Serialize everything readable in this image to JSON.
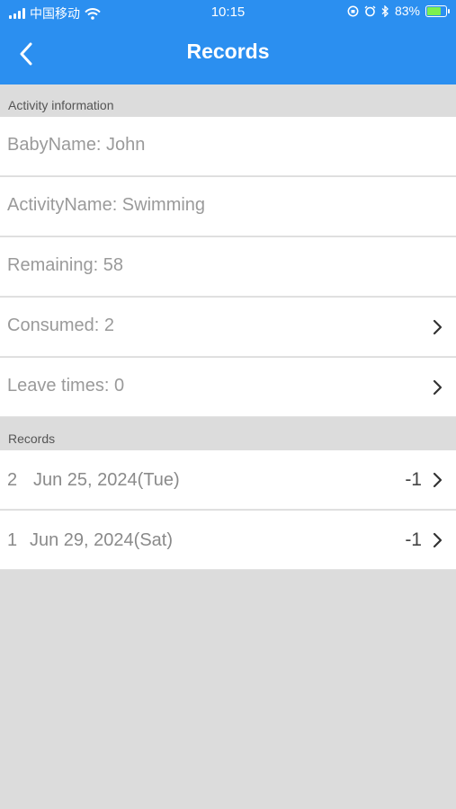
{
  "status_bar": {
    "carrier": "中国移动",
    "time": "10:15",
    "battery_percent": "83%",
    "battery_level": 0.83,
    "icons": [
      "signal-icon",
      "wifi-icon",
      "orientation-lock-icon",
      "alarm-icon",
      "bluetooth-icon",
      "battery-icon"
    ]
  },
  "nav": {
    "title": "Records",
    "back_icon": "chevron-left-icon"
  },
  "colors": {
    "header_bg": "#2b8ff0",
    "page_bg": "#dcdcdc"
  },
  "activity_section": {
    "header": "Activity information",
    "items": [
      {
        "label": "BabyName: John",
        "has_chevron": false
      },
      {
        "label": "ActivityName: Swimming",
        "has_chevron": false
      },
      {
        "label": "Remaining: 58",
        "has_chevron": false
      },
      {
        "label": "Consumed: 2",
        "has_chevron": true
      },
      {
        "label": "Leave times: 0",
        "has_chevron": true
      }
    ]
  },
  "records_section": {
    "header": "Records",
    "items": [
      {
        "index": "2",
        "date": "Jun 25, 2024(Tue)",
        "value": "-1"
      },
      {
        "index": "1",
        "date": "Jun 29, 2024(Sat)",
        "value": "-1"
      }
    ]
  }
}
